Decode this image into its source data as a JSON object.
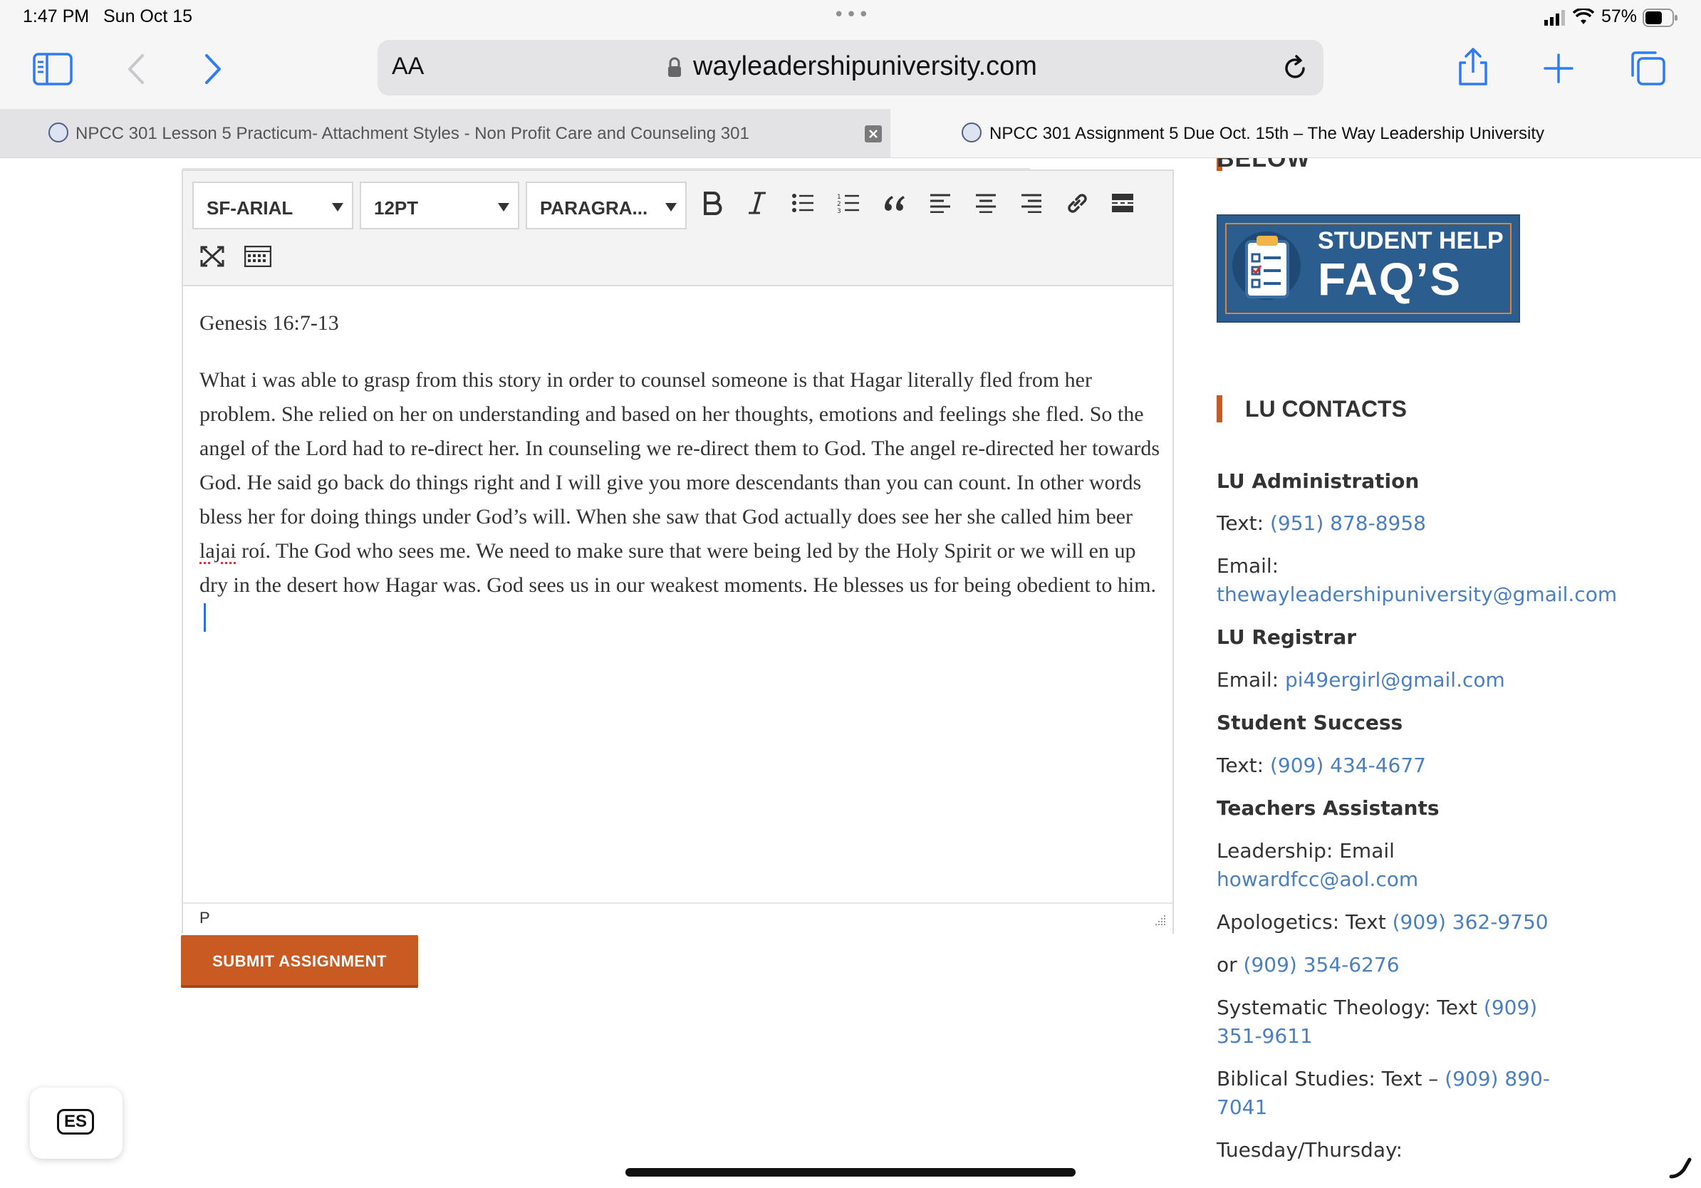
{
  "status_bar": {
    "time": "1:47 PM",
    "date": "Sun Oct 15",
    "dots": "•••",
    "battery": "57%"
  },
  "toolbar": {
    "aa_label": "AA",
    "url": "wayleadershipuniversity.com"
  },
  "tabs": [
    {
      "title": "NPCC 301 Lesson 5 Practicum- Attachment Styles - Non Profit Care and Counseling 301"
    },
    {
      "title": "NPCC 301 Assignment 5 Due Oct. 15th – The Way Leadership University"
    }
  ],
  "editor": {
    "font_family": "SF-ARIAL",
    "font_size": "12PT",
    "block_format": "PARAGRA...",
    "heading": "Genesis 16:7-13",
    "body_before": "What i was able to grasp from this story in order to counsel someone is that Hagar literally fled from her problem. She relied on her on understanding and based on her thoughts, emotions and feelings she fled. So the angel of the Lord had to re-direct her. In counseling we re-direct them to God. The angel re-directed her towards God. He said go back do things right and I will give you more descendants than you can count. In other words bless her for doing things under God’s will. When she saw that God actually does see her she called him beer ",
    "misspelled": "lajai",
    "body_after": " roí. The God who sees me. We need to make sure that were being led by the Holy Spirit or we will en up dry in the desert how Hagar was. God sees us in our weakest moments. He blesses us for being obedient to him.",
    "path": "P"
  },
  "submit_label": "SUBMIT ASSIGNMENT",
  "sidebar": {
    "top_heading": "BELOW",
    "faq_line1": "STUDENT HELP",
    "faq_line2": "FAQ’S",
    "contacts_heading": "LU CONTACTS",
    "admin_title": "LU Administration",
    "admin_text_label": "Text: ",
    "admin_text": "(951) 878-8958",
    "admin_email_label": "Email:",
    "admin_email": "thewayleadershipuniversity@gmail.com",
    "registrar_title": "LU Registrar",
    "registrar_email_label": "Email: ",
    "registrar_email": "pi49ergirl@gmail.com",
    "success_title": "Student Success",
    "success_text_label": "Text: ",
    "success_text": "(909) 434-4677",
    "ta_title": "Teachers Assistants",
    "leadership_label": "Leadership: Email",
    "leadership_email": "howardfcc@aol.com",
    "apologetics_label": "Apologetics: Text ",
    "apologetics_phone": "(909) 362-9750",
    "or_label": "or ",
    "or_phone": "(909) 354-6276",
    "systematic_label": "Systematic Theology: Text ",
    "systematic_phone_a": "(909)",
    "systematic_phone_b": "351-9611",
    "biblical_label": "Biblical Studies: Text – ",
    "biblical_phone_a": "(909) 890-",
    "biblical_phone_b": "7041",
    "tuesday_label": "Tuesday/Thursday:"
  },
  "keyboard_chip": "ES",
  "colors": {
    "accent": "#c85a22",
    "link": "#4a7fc1",
    "ios_blue": "#2f7bf5",
    "faq_blue": "#2c5d8f"
  }
}
